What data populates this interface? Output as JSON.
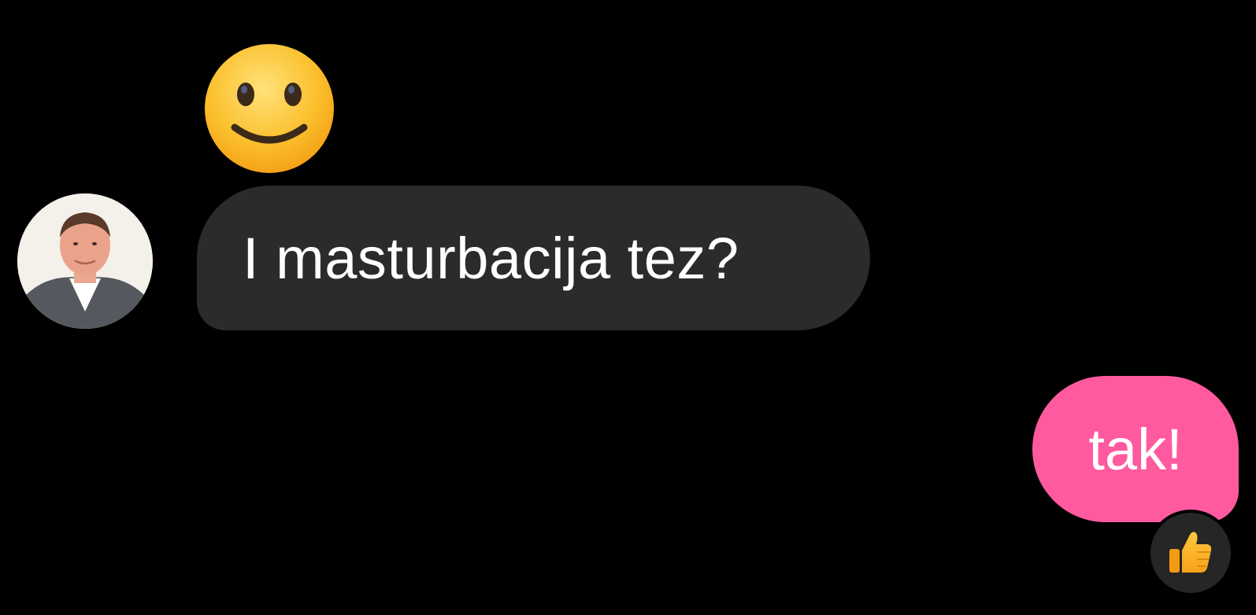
{
  "conversation": {
    "messages": [
      {
        "sender": "other",
        "type": "emoji",
        "emoji": "slightly-smiling-face"
      },
      {
        "sender": "other",
        "type": "text",
        "text": "I masturbacija tez?"
      },
      {
        "sender": "me",
        "type": "text",
        "text": "tak!",
        "reaction": "thumbs-up"
      }
    ]
  },
  "colors": {
    "background": "#000000",
    "incoming_bubble": "#2b2b2b",
    "outgoing_bubble": "#ff5aa0",
    "reaction_bg": "#262626",
    "text": "#ffffff"
  },
  "icons": {
    "avatar": "avatar-photo",
    "emoji": "slightly-smiling-face-icon",
    "reaction": "thumbs-up-icon"
  }
}
